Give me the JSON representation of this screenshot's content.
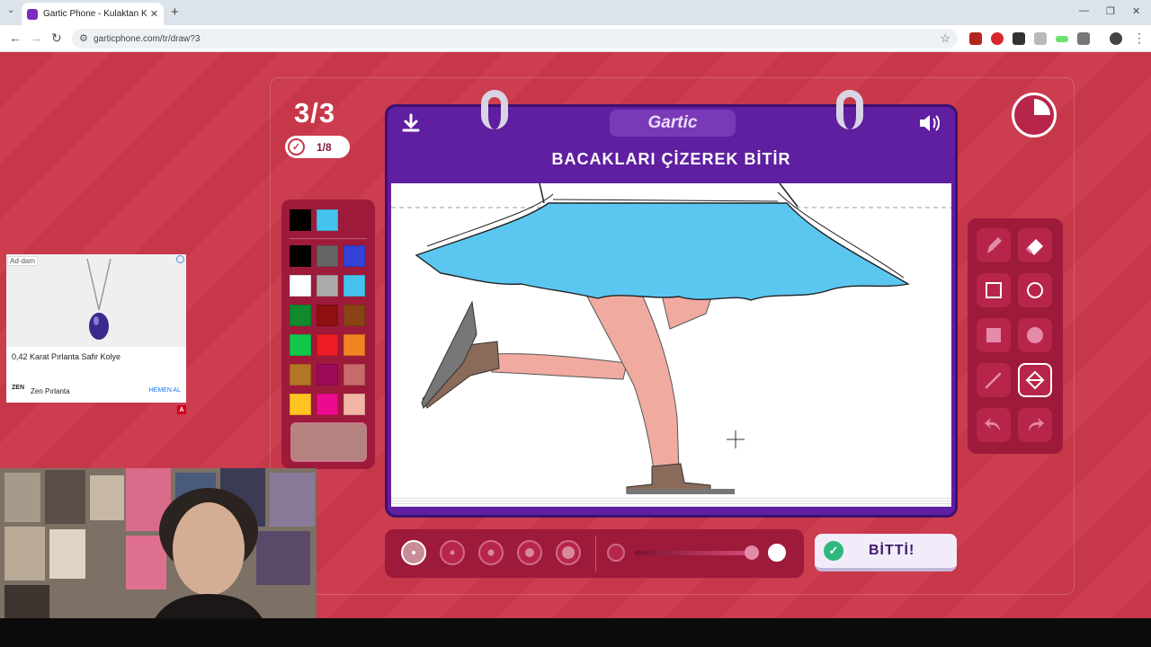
{
  "browser": {
    "tab_title": "Gartic Phone - Kulaktan Kulağa",
    "url": "garticphone.com/tr/draw?3",
    "newtab_icon": "plus-icon"
  },
  "game": {
    "round": "3/3",
    "completed_count": "1/8",
    "logo": "Gartic",
    "instruction": "BACAKLARI ÇİZEREK BİTİR",
    "done_label": "BİTTİ!",
    "palette": {
      "top_colors": [
        "#000000",
        "#45c3ef"
      ],
      "colors": [
        [
          "#000000",
          "#666666",
          "#3341d6"
        ],
        [
          "#ffffff",
          "#aaaaaa",
          "#45c3ef"
        ],
        [
          "#118a2e",
          "#8e0f0f",
          "#8a4314"
        ],
        [
          "#11c84a",
          "#ee1c24",
          "#f28322"
        ],
        [
          "#b47524",
          "#9b0a58",
          "#c96a6a"
        ],
        [
          "#ffc421",
          "#ee0a8e",
          "#f4b5a6"
        ]
      ],
      "selected_color": "#b5837f"
    },
    "tools": [
      "pencil-icon",
      "eraser-icon",
      "square-outline-icon",
      "circle-outline-icon",
      "square-filled-icon",
      "circle-filled-icon",
      "line-icon",
      "fill-bucket-icon",
      "undo-icon",
      "redo-icon"
    ],
    "active_tool": "fill-bucket-icon"
  },
  "ad": {
    "label": "Ad·dam",
    "title": "0,42 Karat Pırlanta Safir Kolye",
    "brand": "Zen Pırlanta",
    "cta": "HEMEN AL"
  }
}
